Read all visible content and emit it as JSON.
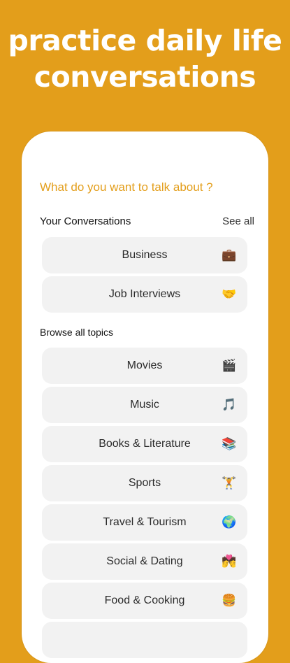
{
  "headline": {
    "line1": "practice daily life",
    "line2": "conversations"
  },
  "card": {
    "question": "What do you want to talk about ?",
    "your_conversations": {
      "title": "Your Conversations",
      "see_all": "See all",
      "items": [
        {
          "label": "Business",
          "icon": "💼"
        },
        {
          "label": "Job Interviews",
          "icon": "🤝"
        }
      ]
    },
    "browse": {
      "title": "Browse all topics",
      "items": [
        {
          "label": "Movies",
          "icon": "🎬"
        },
        {
          "label": "Music",
          "icon": "🎵"
        },
        {
          "label": "Books & Literature",
          "icon": "📚"
        },
        {
          "label": "Sports",
          "icon": "🏋"
        },
        {
          "label": "Travel & Tourism",
          "icon": "🌍"
        },
        {
          "label": "Social & Dating",
          "icon": "💏"
        },
        {
          "label": "Food & Cooking",
          "icon": "🍔"
        }
      ]
    }
  },
  "colors": {
    "background": "#E39E1B",
    "accent": "#E39E1B",
    "tile": "#F2F2F2"
  }
}
